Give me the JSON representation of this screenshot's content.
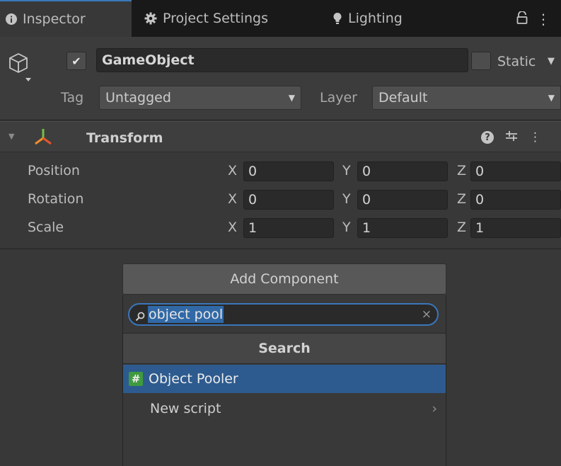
{
  "tabs": [
    {
      "label": "Inspector",
      "icon": "info-icon"
    },
    {
      "label": "Project Settings",
      "icon": "gear-icon"
    },
    {
      "label": "Lighting",
      "icon": "lightbulb-icon"
    }
  ],
  "tab_menu": {
    "lock_glyph": "ɐ",
    "more_glyph": "⋮"
  },
  "game_object": {
    "name": "GameObject",
    "active": true,
    "static_label": "Static",
    "static_arrow": "▼",
    "tag_label": "Tag",
    "tag_value": "Untagged",
    "layer_label": "Layer",
    "layer_value": "Default",
    "dropdown_arrow": "▼"
  },
  "transform": {
    "foldout": "▼",
    "title": "Transform",
    "help": "?",
    "presets": "⊥",
    "more": "⋮",
    "rows": [
      {
        "label": "Position",
        "x": "0",
        "y": "0",
        "z": "0"
      },
      {
        "label": "Rotation",
        "x": "0",
        "y": "0",
        "z": "0"
      },
      {
        "label": "Scale",
        "x": "1",
        "y": "1",
        "z": "1"
      }
    ],
    "axis_x": "X",
    "axis_y": "Y",
    "axis_z": "Z"
  },
  "add_component": {
    "button_label": "Add Component",
    "search_value": "object pool",
    "clear_glyph": "×",
    "section_header": "Search",
    "results": [
      {
        "label": "Object Pooler",
        "icon_glyph": "#",
        "selected": true
      },
      {
        "label": "New script",
        "arrow": "›",
        "selected": false
      }
    ]
  },
  "colors": {
    "accent": "#3b76ba",
    "selection": "#2d5b8f",
    "panel": "#383838",
    "script_icon": "#3f9a3f"
  }
}
